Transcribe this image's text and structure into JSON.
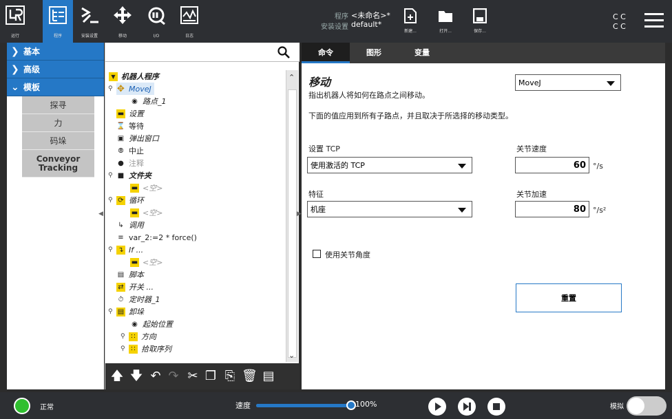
{
  "header": {
    "nav": [
      {
        "label": "运行",
        "icon": "robot-logo-icon"
      },
      {
        "label": "程序",
        "icon": "program-icon"
      },
      {
        "label": "安装设置",
        "icon": "installation-icon"
      },
      {
        "label": "移动",
        "icon": "move-icon"
      },
      {
        "label": "I/O",
        "icon": "io-icon"
      },
      {
        "label": "日志",
        "icon": "log-icon"
      }
    ],
    "program_key": "程序",
    "program_value": "<未命名>*",
    "install_key": "安装设置",
    "install_value": "default*",
    "file_new": "新建...",
    "file_open": "打开...",
    "file_save": "保存...",
    "cc_top": "C C",
    "cc_bottom": "C C"
  },
  "nav": {
    "basic": "基本",
    "advanced": "高级",
    "template": "模板",
    "items": [
      "探寻",
      "力",
      "码垛",
      "Conveyor Tracking"
    ]
  },
  "tree": {
    "search_placeholder": "",
    "rows": [
      "机器人程序",
      "MoveJ",
      "路点_1",
      "设置",
      "等待",
      "弹出窗口",
      "中止",
      "注释",
      "文件夹",
      "<空>",
      "循环",
      "<空>",
      "调用",
      "var_2:=2 * force()",
      "If ...",
      "<空>",
      "脚本",
      "开关 ...",
      "定时器_1",
      "卸垛",
      "起始位置",
      "方向",
      "拾取序列"
    ]
  },
  "tabs": [
    "命令",
    "图形",
    "变量"
  ],
  "panel": {
    "title": "移动",
    "desc": "指出机器人将如何在路点之间移动。",
    "note": "下面的值应用到所有子路点，并且取决于所选择的移动类型。",
    "move_type": "MoveJ",
    "tcp_label": "设置 TCP",
    "tcp_value": "使用激活的 TCP",
    "feature_label": "特征",
    "feature_value": "机座",
    "speed_label": "关节速度",
    "speed_value": "60",
    "speed_unit": "°/s",
    "accel_label": "关节加速",
    "accel_value": "80",
    "accel_unit": "°/s²",
    "joint_angle_label": "使用关节角度",
    "reset_label": "重置"
  },
  "footer": {
    "status": "正常",
    "speed_label": "速度",
    "speed_value": "100%",
    "speed_fraction": 1.0,
    "sim_label": "模拟"
  },
  "colors": {
    "accent": "#2578c6",
    "status_ok": "#2fbf2f"
  }
}
